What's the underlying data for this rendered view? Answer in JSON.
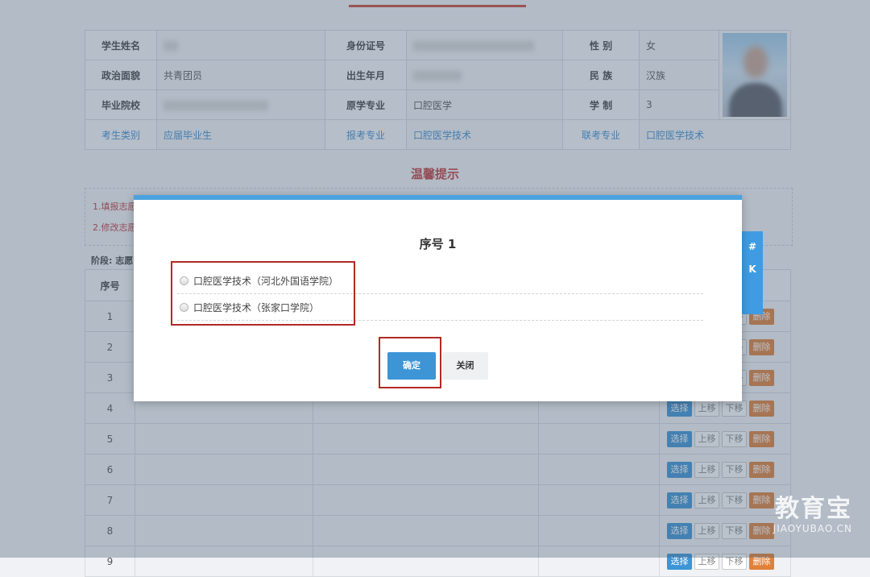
{
  "info_table": {
    "rows": [
      {
        "l1": "学生姓名",
        "v1": "",
        "l2": "身份证号",
        "v2": "",
        "l3": "性  别",
        "v3": "女"
      },
      {
        "l1": "政治面貌",
        "v1": "共青团员",
        "l2": "出生年月",
        "v2": "",
        "l3": "民  族",
        "v3": "汉族"
      },
      {
        "l1": "毕业院校",
        "v1": "",
        "l2": "原学专业",
        "v2": "口腔医学",
        "l3": "学  制",
        "v3": "3"
      },
      {
        "l1": "考生类别",
        "v1": "应届毕业生",
        "l2": "报考专业",
        "v2": "口腔医学技术",
        "l3": "联考专业",
        "v3": "口腔医学技术"
      }
    ]
  },
  "tips": {
    "title": "温馨提示",
    "line1": "1.填报志愿",
    "line2": "2.修改志愿"
  },
  "stage_label": "阶段: 志愿",
  "volunteer_table": {
    "header_no": "序号",
    "rows": [
      "1",
      "2",
      "3",
      "4",
      "5",
      "6",
      "7",
      "8",
      "9"
    ],
    "actions": {
      "select": "选择",
      "up": "上移",
      "down": "下移",
      "delete": "删除"
    }
  },
  "side_tab": {
    "line1": "#",
    "line2": "K"
  },
  "modal": {
    "title": "序号 1",
    "options": [
      "口腔医学技术（河北外国语学院）",
      "口腔医学技术（张家口学院）"
    ],
    "ok_label": "确定",
    "close_label": "关闭"
  },
  "watermark": {
    "main": "教育宝",
    "sub": "JIAOYUBAO.CN"
  },
  "colors": {
    "accent": "#3d95d6",
    "highlight": "#b22a22",
    "tip_red": "#c23d3d",
    "delete": "#e0813a"
  }
}
